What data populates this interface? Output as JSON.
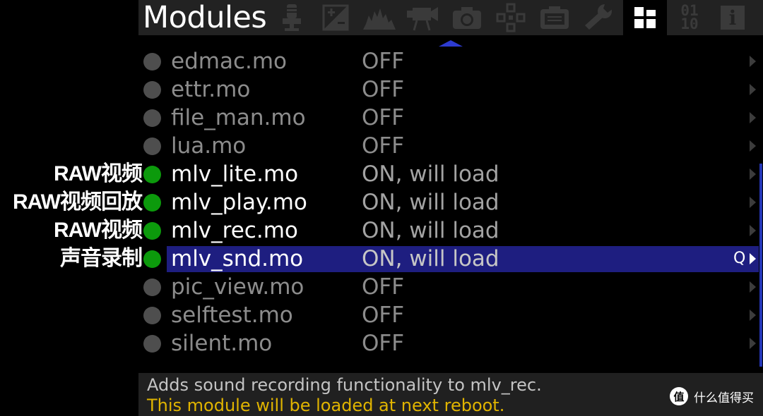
{
  "header": {
    "title": "Modules",
    "tabs": [
      {
        "icon": "microphone-icon",
        "active": false
      },
      {
        "icon": "exposure-icon",
        "active": false
      },
      {
        "icon": "histogram-icon",
        "active": false
      },
      {
        "icon": "movie-camera-icon",
        "active": false
      },
      {
        "icon": "camera-icon",
        "active": false
      },
      {
        "icon": "focus-cross-icon",
        "active": false
      },
      {
        "icon": "display-icon",
        "active": false
      },
      {
        "icon": "wrench-icon",
        "active": false
      },
      {
        "icon": "modules-grid-icon",
        "active": true
      },
      {
        "icon": "debug-binary-icon",
        "active": false
      },
      {
        "icon": "info-icon",
        "active": false
      }
    ],
    "debug_icon_text": [
      "01",
      "10"
    ],
    "info_icon_text": "i"
  },
  "modules": [
    {
      "name": "edmac.mo",
      "status": "OFF",
      "on": false,
      "annotation": ""
    },
    {
      "name": "ettr.mo",
      "status": "OFF",
      "on": false,
      "annotation": ""
    },
    {
      "name": "file_man.mo",
      "status": "OFF",
      "on": false,
      "annotation": ""
    },
    {
      "name": "lua.mo",
      "status": "OFF",
      "on": false,
      "annotation": ""
    },
    {
      "name": "mlv_lite.mo",
      "status": "ON, will load",
      "on": true,
      "annotation": "RAW视频"
    },
    {
      "name": "mlv_play.mo",
      "status": "ON, will load",
      "on": true,
      "annotation": "RAW视频回放"
    },
    {
      "name": "mlv_rec.mo",
      "status": "ON, will load",
      "on": true,
      "annotation": "RAW视频"
    },
    {
      "name": "mlv_snd.mo",
      "status": "ON, will load",
      "on": true,
      "annotation": "声音录制",
      "selected": true,
      "quick_key": "Q"
    },
    {
      "name": "pic_view.mo",
      "status": "OFF",
      "on": false,
      "annotation": ""
    },
    {
      "name": "selftest.mo",
      "status": "OFF",
      "on": false,
      "annotation": ""
    },
    {
      "name": "silent.mo",
      "status": "OFF",
      "on": false,
      "annotation": ""
    }
  ],
  "help": {
    "description": "Adds sound recording functionality to mlv_rec.",
    "warning": "This module will be loaded at next reboot."
  },
  "watermark": {
    "logo_text": "值",
    "text": "什么值得买"
  },
  "colors": {
    "on_dot": "#0c9a0c",
    "off_dot": "#4e4e4e",
    "selection": "#1e1e80",
    "warning_text": "#e0b400",
    "tab_indicator": "#2d3bd1"
  }
}
